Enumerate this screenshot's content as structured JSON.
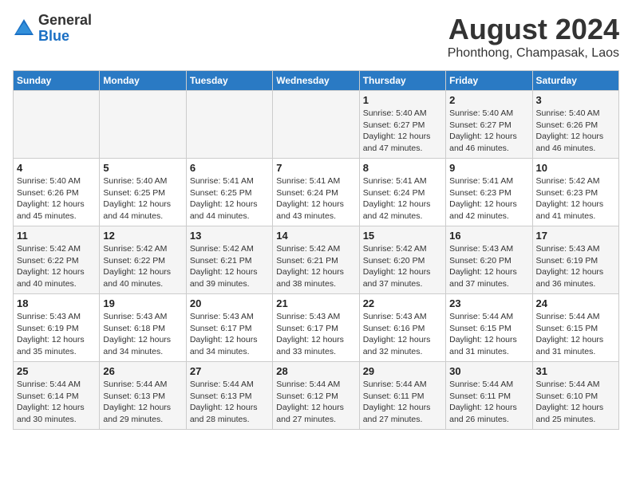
{
  "logo": {
    "general": "General",
    "blue": "Blue"
  },
  "title": "August 2024",
  "subtitle": "Phonthong, Champasak, Laos",
  "days_of_week": [
    "Sunday",
    "Monday",
    "Tuesday",
    "Wednesday",
    "Thursday",
    "Friday",
    "Saturday"
  ],
  "weeks": [
    [
      {
        "day": "",
        "info": ""
      },
      {
        "day": "",
        "info": ""
      },
      {
        "day": "",
        "info": ""
      },
      {
        "day": "",
        "info": ""
      },
      {
        "day": "1",
        "info": "Sunrise: 5:40 AM\nSunset: 6:27 PM\nDaylight: 12 hours and 47 minutes."
      },
      {
        "day": "2",
        "info": "Sunrise: 5:40 AM\nSunset: 6:27 PM\nDaylight: 12 hours and 46 minutes."
      },
      {
        "day": "3",
        "info": "Sunrise: 5:40 AM\nSunset: 6:26 PM\nDaylight: 12 hours and 46 minutes."
      }
    ],
    [
      {
        "day": "4",
        "info": "Sunrise: 5:40 AM\nSunset: 6:26 PM\nDaylight: 12 hours and 45 minutes."
      },
      {
        "day": "5",
        "info": "Sunrise: 5:40 AM\nSunset: 6:25 PM\nDaylight: 12 hours and 44 minutes."
      },
      {
        "day": "6",
        "info": "Sunrise: 5:41 AM\nSunset: 6:25 PM\nDaylight: 12 hours and 44 minutes."
      },
      {
        "day": "7",
        "info": "Sunrise: 5:41 AM\nSunset: 6:24 PM\nDaylight: 12 hours and 43 minutes."
      },
      {
        "day": "8",
        "info": "Sunrise: 5:41 AM\nSunset: 6:24 PM\nDaylight: 12 hours and 42 minutes."
      },
      {
        "day": "9",
        "info": "Sunrise: 5:41 AM\nSunset: 6:23 PM\nDaylight: 12 hours and 42 minutes."
      },
      {
        "day": "10",
        "info": "Sunrise: 5:42 AM\nSunset: 6:23 PM\nDaylight: 12 hours and 41 minutes."
      }
    ],
    [
      {
        "day": "11",
        "info": "Sunrise: 5:42 AM\nSunset: 6:22 PM\nDaylight: 12 hours and 40 minutes."
      },
      {
        "day": "12",
        "info": "Sunrise: 5:42 AM\nSunset: 6:22 PM\nDaylight: 12 hours and 40 minutes."
      },
      {
        "day": "13",
        "info": "Sunrise: 5:42 AM\nSunset: 6:21 PM\nDaylight: 12 hours and 39 minutes."
      },
      {
        "day": "14",
        "info": "Sunrise: 5:42 AM\nSunset: 6:21 PM\nDaylight: 12 hours and 38 minutes."
      },
      {
        "day": "15",
        "info": "Sunrise: 5:42 AM\nSunset: 6:20 PM\nDaylight: 12 hours and 37 minutes."
      },
      {
        "day": "16",
        "info": "Sunrise: 5:43 AM\nSunset: 6:20 PM\nDaylight: 12 hours and 37 minutes."
      },
      {
        "day": "17",
        "info": "Sunrise: 5:43 AM\nSunset: 6:19 PM\nDaylight: 12 hours and 36 minutes."
      }
    ],
    [
      {
        "day": "18",
        "info": "Sunrise: 5:43 AM\nSunset: 6:19 PM\nDaylight: 12 hours and 35 minutes."
      },
      {
        "day": "19",
        "info": "Sunrise: 5:43 AM\nSunset: 6:18 PM\nDaylight: 12 hours and 34 minutes."
      },
      {
        "day": "20",
        "info": "Sunrise: 5:43 AM\nSunset: 6:17 PM\nDaylight: 12 hours and 34 minutes."
      },
      {
        "day": "21",
        "info": "Sunrise: 5:43 AM\nSunset: 6:17 PM\nDaylight: 12 hours and 33 minutes."
      },
      {
        "day": "22",
        "info": "Sunrise: 5:43 AM\nSunset: 6:16 PM\nDaylight: 12 hours and 32 minutes."
      },
      {
        "day": "23",
        "info": "Sunrise: 5:44 AM\nSunset: 6:15 PM\nDaylight: 12 hours and 31 minutes."
      },
      {
        "day": "24",
        "info": "Sunrise: 5:44 AM\nSunset: 6:15 PM\nDaylight: 12 hours and 31 minutes."
      }
    ],
    [
      {
        "day": "25",
        "info": "Sunrise: 5:44 AM\nSunset: 6:14 PM\nDaylight: 12 hours and 30 minutes."
      },
      {
        "day": "26",
        "info": "Sunrise: 5:44 AM\nSunset: 6:13 PM\nDaylight: 12 hours and 29 minutes."
      },
      {
        "day": "27",
        "info": "Sunrise: 5:44 AM\nSunset: 6:13 PM\nDaylight: 12 hours and 28 minutes."
      },
      {
        "day": "28",
        "info": "Sunrise: 5:44 AM\nSunset: 6:12 PM\nDaylight: 12 hours and 27 minutes."
      },
      {
        "day": "29",
        "info": "Sunrise: 5:44 AM\nSunset: 6:11 PM\nDaylight: 12 hours and 27 minutes."
      },
      {
        "day": "30",
        "info": "Sunrise: 5:44 AM\nSunset: 6:11 PM\nDaylight: 12 hours and 26 minutes."
      },
      {
        "day": "31",
        "info": "Sunrise: 5:44 AM\nSunset: 6:10 PM\nDaylight: 12 hours and 25 minutes."
      }
    ]
  ]
}
